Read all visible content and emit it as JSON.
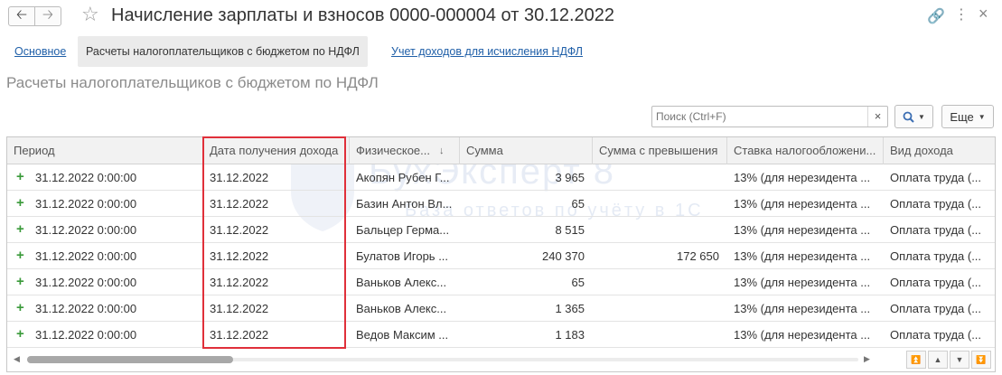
{
  "window": {
    "title": "Начисление зарплаты и взносов 0000-000004 от 30.12.2022"
  },
  "tabs": [
    {
      "label": "Основное",
      "active": false
    },
    {
      "label": "Расчеты налогоплательщиков с бюджетом по НДФЛ",
      "active": true
    },
    {
      "label": "Учет доходов для исчисления НДФЛ",
      "active": false
    }
  ],
  "section_title": "Расчеты налогоплательщиков с бюджетом по НДФЛ",
  "toolbar": {
    "search_placeholder": "Поиск (Ctrl+F)",
    "clear_glyph": "×",
    "more_label": "Еще"
  },
  "table": {
    "columns": [
      "Период",
      "Дата получения дохода",
      "Физическое...",
      "Сумма",
      "Сумма с превышения",
      "Ставка налогообложени...",
      "Вид дохода"
    ],
    "rows": [
      {
        "period": "31.12.2022 0:00:00",
        "date": "31.12.2022",
        "person": "Акопян Рубен Г...",
        "sum": "3 965",
        "excess": "",
        "rate": "13% (для нерезидента ...",
        "kind": "Оплата труда (..."
      },
      {
        "period": "31.12.2022 0:00:00",
        "date": "31.12.2022",
        "person": "Базин Антон Вл...",
        "sum": "65",
        "excess": "",
        "rate": "13% (для нерезидента ...",
        "kind": "Оплата труда (..."
      },
      {
        "period": "31.12.2022 0:00:00",
        "date": "31.12.2022",
        "person": "Бальцер Герма...",
        "sum": "8 515",
        "excess": "",
        "rate": "13% (для нерезидента ...",
        "kind": "Оплата труда (..."
      },
      {
        "period": "31.12.2022 0:00:00",
        "date": "31.12.2022",
        "person": "Булатов Игорь ...",
        "sum": "240 370",
        "excess": "172 650",
        "rate": "13% (для нерезидента ...",
        "kind": "Оплата труда (..."
      },
      {
        "period": "31.12.2022 0:00:00",
        "date": "31.12.2022",
        "person": "Ваньков Алекс...",
        "sum": "65",
        "excess": "",
        "rate": "13% (для нерезидента ...",
        "kind": "Оплата труда (..."
      },
      {
        "period": "31.12.2022 0:00:00",
        "date": "31.12.2022",
        "person": "Ваньков Алекс...",
        "sum": "1 365",
        "excess": "",
        "rate": "13% (для нерезидента ...",
        "kind": "Оплата труда (..."
      },
      {
        "period": "31.12.2022 0:00:00",
        "date": "31.12.2022",
        "person": "Ведов Максим ...",
        "sum": "1 183",
        "excess": "",
        "rate": "13% (для нерезидента ...",
        "kind": "Оплата труда (..."
      }
    ]
  },
  "watermark": {
    "brand": "БухЭксперт 8",
    "subtitle": "База ответов по учёту в 1С"
  },
  "colors": {
    "link": "#1f5fa8",
    "highlight": "#e0303a",
    "plus": "#3a9a3a"
  }
}
